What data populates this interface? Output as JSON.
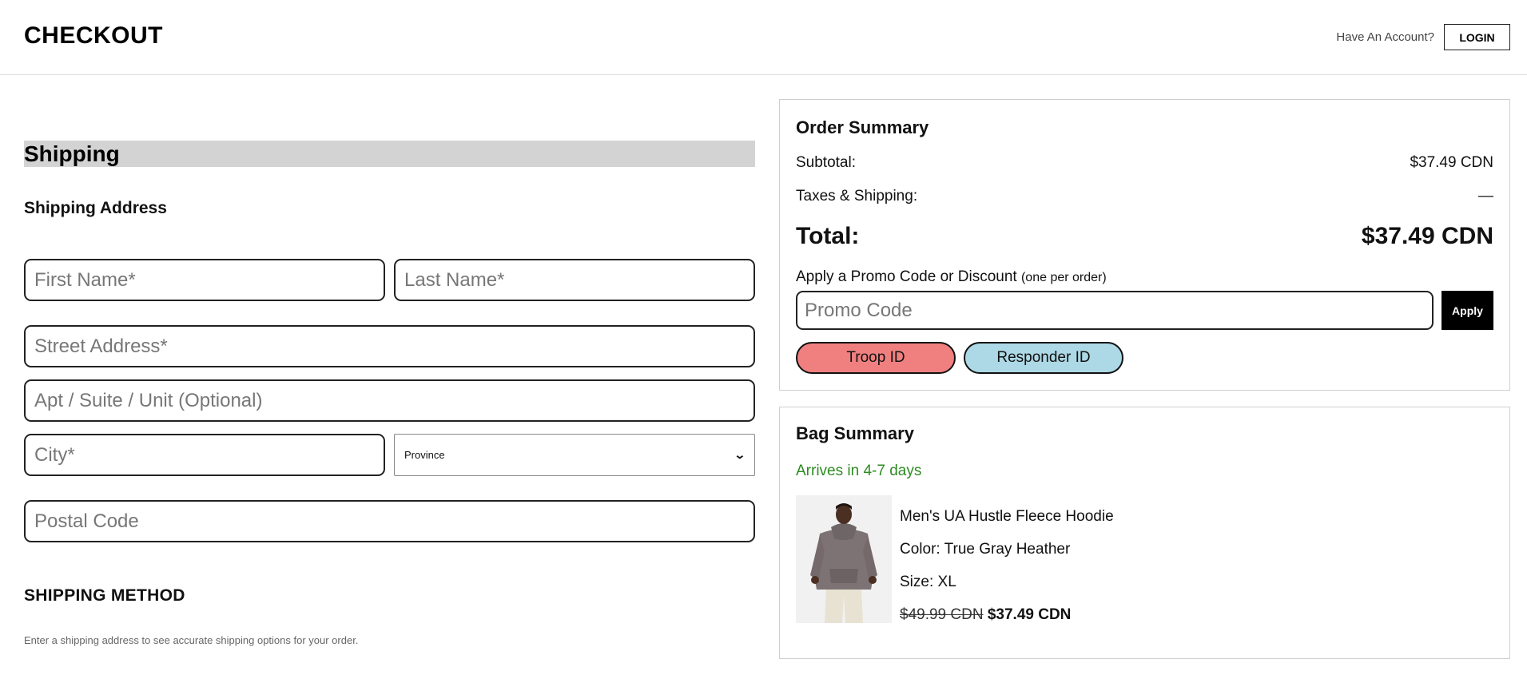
{
  "header": {
    "brand": "CHECKOUT",
    "account_prompt": "Have An Account?",
    "login_label": "LOGIN"
  },
  "shipping": {
    "section_title": "Shipping",
    "address_heading": "Shipping Address",
    "first_name_placeholder": "First Name*",
    "last_name_placeholder": "Last Name*",
    "street_placeholder": "Street Address*",
    "apt_placeholder": "Apt / Suite / Unit (Optional)",
    "city_placeholder": "City*",
    "province_selected": "Province",
    "postal_placeholder": "Postal Code",
    "method_heading": "SHIPPING METHOD",
    "method_note": "Enter a shipping address to see accurate shipping options for your order."
  },
  "order_summary": {
    "title": "Order Summary",
    "subtotal_label": "Subtotal:",
    "subtotal_value": "$37.49 CDN",
    "taxes_label": "Taxes & Shipping:",
    "taxes_value": "—",
    "total_label": "Total:",
    "total_value": "$37.49 CDN",
    "promo_label": "Apply a Promo Code or Discount",
    "promo_note": "(one per order)",
    "promo_placeholder": "Promo Code",
    "apply_label": "Apply",
    "troop_label": "Troop ID",
    "responder_label": "Responder ID",
    "colors": {
      "troop": "#f08080",
      "responder": "#add8e6"
    }
  },
  "bag_summary": {
    "title": "Bag Summary",
    "arrival": "Arrives in 4-7 days",
    "arrival_color": "#2e8b22",
    "item": {
      "name": "Men's UA Hustle Fleece Hoodie",
      "color": "Color: True Gray Heather",
      "size": "Size: XL",
      "original_price": "$49.99 CDN",
      "sale_price": "$37.49 CDN"
    }
  }
}
